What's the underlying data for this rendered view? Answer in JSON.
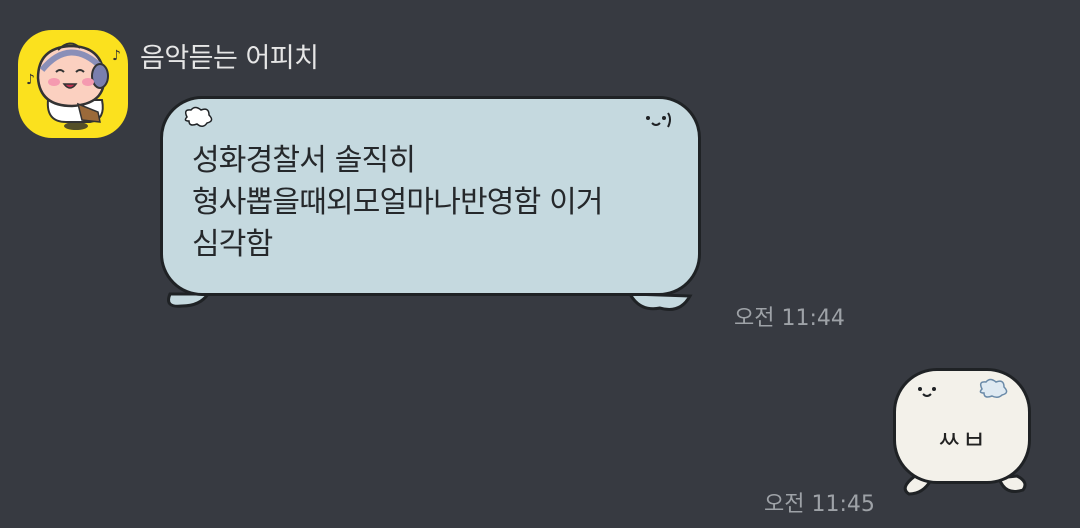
{
  "chat": {
    "sender_name": "음악듣는 어피치",
    "avatar_icon": "apeach-headphones-icon",
    "messages": [
      {
        "direction": "incoming",
        "text": "성화경찰서 솔직히\n형사뽑을때외모얼마나반영함 이거\n심각함",
        "time": "오전 11:44"
      },
      {
        "direction": "outgoing",
        "text": "ㅆㅂ",
        "time": "오전 11:45"
      }
    ]
  },
  "colors": {
    "background": "#373a41",
    "incoming_bubble": "#c5d9df",
    "outgoing_bubble": "#f3f1ea",
    "avatar_background": "#fbe11e"
  }
}
